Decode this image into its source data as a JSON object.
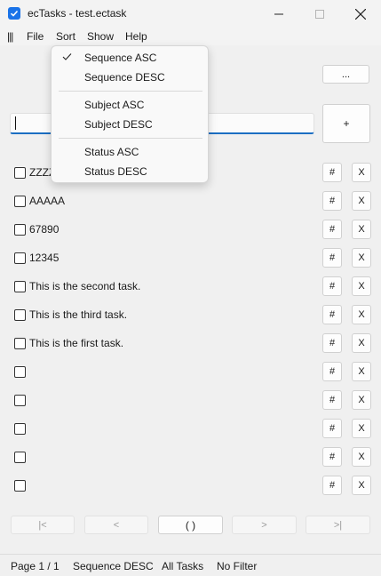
{
  "window": {
    "title": "ecTasks - test.ectask",
    "icon": "checkbox-app-icon",
    "accent": "#1a73e8"
  },
  "menubar": {
    "grip": "|||",
    "items": [
      {
        "label": "File"
      },
      {
        "label": "Sort"
      },
      {
        "label": "Show"
      },
      {
        "label": "Help"
      }
    ]
  },
  "sort_menu": {
    "items": [
      {
        "label": "Sequence ASC",
        "checked": true
      },
      {
        "label": "Sequence DESC",
        "checked": false
      },
      {
        "label": "Subject ASC",
        "checked": false
      },
      {
        "label": "Subject DESC",
        "checked": false
      },
      {
        "label": "Status ASC",
        "checked": false
      },
      {
        "label": "Status DESC",
        "checked": false
      }
    ]
  },
  "toolbar": {
    "more_label": "...",
    "add_label": "+",
    "input_value": ""
  },
  "tasks": [
    {
      "label": "ZZZZ",
      "checked": false
    },
    {
      "label": "AAAAA",
      "checked": false
    },
    {
      "label": "67890",
      "checked": false
    },
    {
      "label": "12345",
      "checked": false
    },
    {
      "label": "This is the second task.",
      "checked": false
    },
    {
      "label": "This is the third task.",
      "checked": false
    },
    {
      "label": "This is the first task.",
      "checked": false
    },
    {
      "label": "",
      "checked": false
    },
    {
      "label": "",
      "checked": false
    },
    {
      "label": "",
      "checked": false
    },
    {
      "label": "",
      "checked": false
    },
    {
      "label": "",
      "checked": false
    }
  ],
  "row_buttons": {
    "hash_label": "#",
    "delete_label": "X"
  },
  "pager": {
    "first_label": "|<",
    "prev_label": "<",
    "current_label": "( )",
    "next_label": ">",
    "last_label": ">|"
  },
  "status": {
    "page": "Page 1 / 1",
    "sort": "Sequence DESC",
    "show": "All Tasks",
    "filter": "No Filter"
  }
}
